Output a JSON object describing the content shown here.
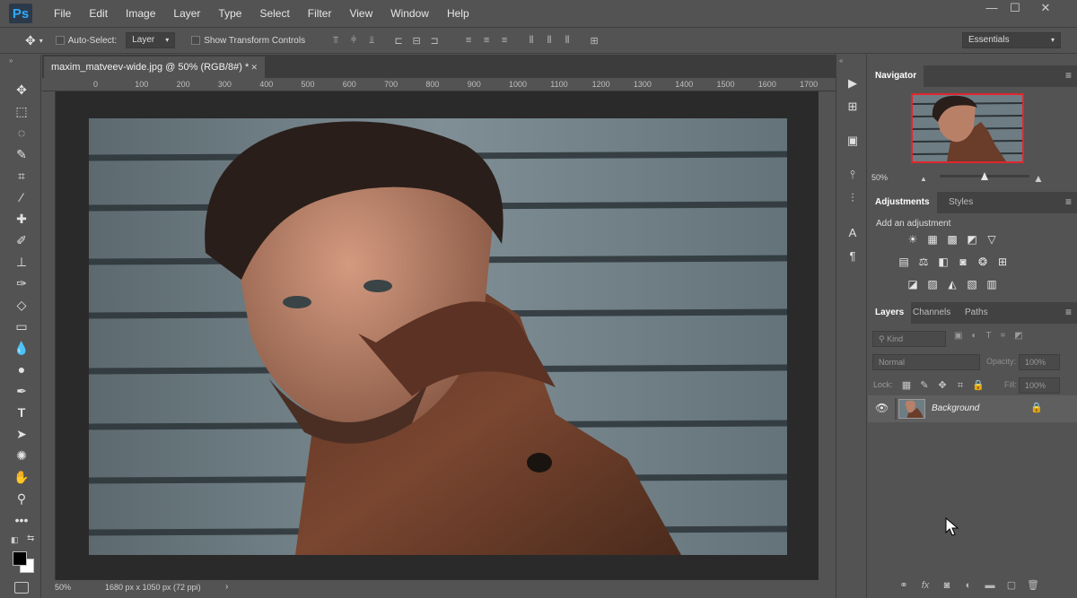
{
  "app": {
    "logo": "Ps",
    "accent": "#31a8ff"
  },
  "menu": [
    "File",
    "Edit",
    "Image",
    "Layer",
    "Type",
    "Select",
    "Filter",
    "View",
    "Window",
    "Help"
  ],
  "window_controls": {
    "minimize": "—",
    "maximize": "☐",
    "close": "✕"
  },
  "options": {
    "auto_select_label": "Auto-Select:",
    "auto_select_value": "Layer",
    "show_transform_label": "Show Transform Controls",
    "workspace": "Essentials"
  },
  "document": {
    "tab_title": "maxim_matveev-wide.jpg @ 50% (RGB/8#) *",
    "tab_close": "✕",
    "zoom": "50%",
    "info": "1680 px x 1050 px (72 ppi)",
    "ruler_ticks": [
      "0",
      "100",
      "200",
      "300",
      "400",
      "500",
      "600",
      "700",
      "800",
      "900",
      "1000",
      "1100",
      "1200",
      "1300",
      "1400",
      "1500",
      "1600",
      "1700"
    ]
  },
  "navigator": {
    "title": "Navigator",
    "zoom": "50%",
    "zoom_fraction": 0.5,
    "frame_color": "#e0262e"
  },
  "adjustments": {
    "tabs": [
      "Adjustments",
      "Styles"
    ],
    "heading": "Add an adjustment",
    "icons_row1": [
      "brightness-icon",
      "levels-icon",
      "curves-icon",
      "exposure-icon",
      "vibrance-icon"
    ],
    "icons_row2": [
      "hue-saturation-icon",
      "color-balance-icon",
      "black-white-icon",
      "photo-filter-icon",
      "channel-mixer-icon",
      "color-lookup-icon"
    ],
    "icons_row3": [
      "invert-icon",
      "posterize-icon",
      "threshold-icon",
      "selective-color-icon",
      "gradient-map-icon"
    ]
  },
  "layers": {
    "tabs": [
      "Layers",
      "Channels",
      "Paths"
    ],
    "filter_kind": "Kind",
    "blend_mode": "Normal",
    "opacity_label": "Opacity:",
    "opacity_value": "100%",
    "lock_label": "Lock:",
    "fill_label": "Fill:",
    "fill_value": "100%",
    "items": [
      {
        "name": "Background",
        "visible": true,
        "locked": true
      }
    ]
  }
}
